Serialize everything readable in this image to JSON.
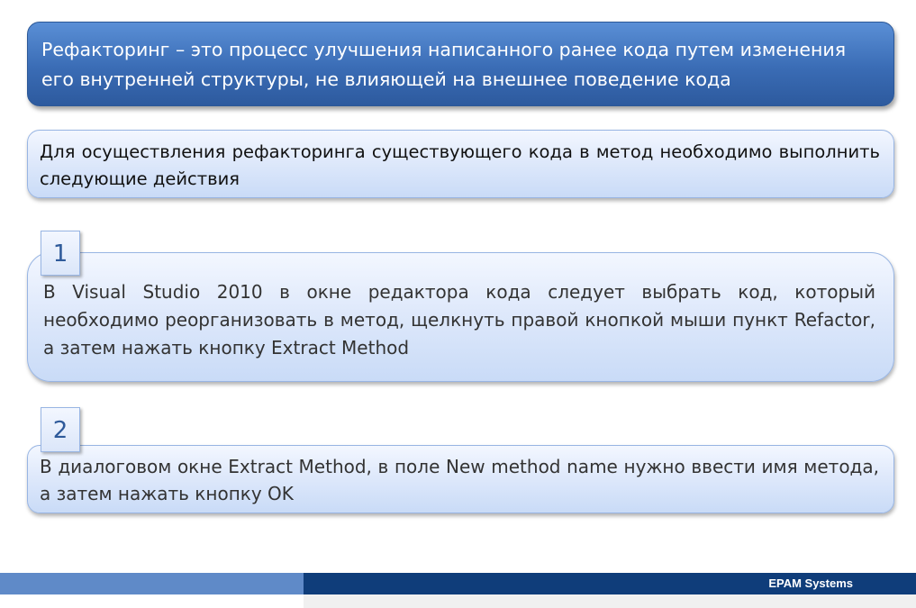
{
  "title": {
    "text": "Рефакторинг –  это процесс улучшения написанного ранее кода путем изменения его внутренней структуры, не влияющей на внешнее поведение кода"
  },
  "intro": {
    "text": "Для осуществления рефакторинга существующего кода в метод необходимо выполнить следующие действия"
  },
  "steps": [
    {
      "number": "1",
      "text": "В Visual Studio 2010 в окне редактора кода следует выбрать код, который необходимо реорганизовать в метод, щелкнуть правой кнопкой мыши пункт Refactor, а затем нажать кнопку Extract Method"
    },
    {
      "number": "2",
      "text": "В диалоговом окне Extract Method, в поле New method name нужно ввести имя метода, а затем нажать кнопку OK"
    }
  ],
  "footer": {
    "brand": "EPAM Systems"
  },
  "colors": {
    "title_fill": "#3a6cb5",
    "box_fill": "#dfe9fb",
    "footer_dark": "#0f3d7a",
    "footer_light": "#5f8ac8"
  }
}
